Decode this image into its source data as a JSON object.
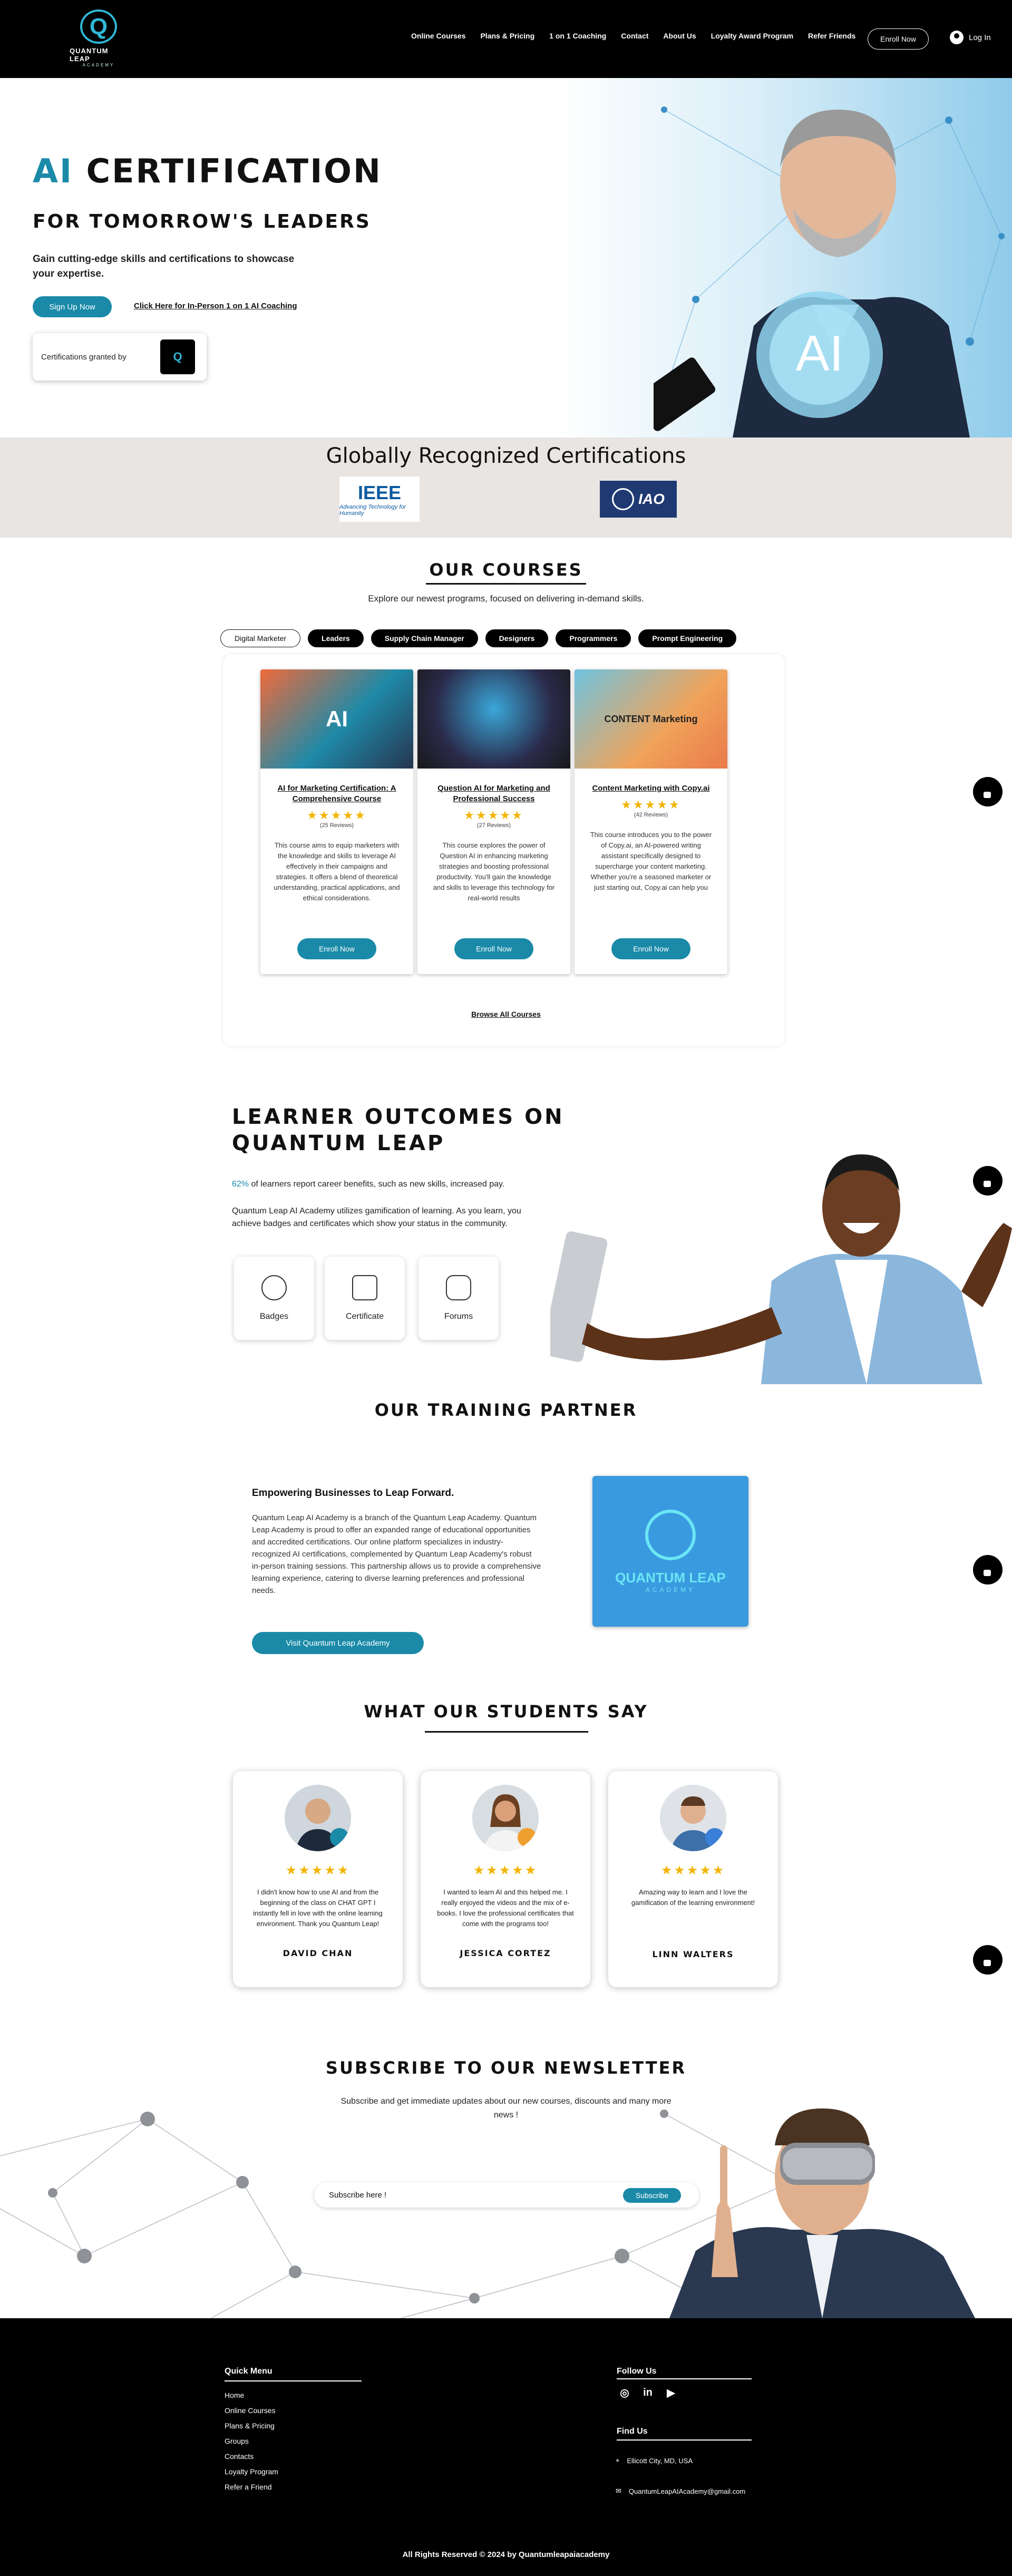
{
  "header": {
    "logo_text": "QUANTUM LEAP",
    "logo_sub": "ACADEMY",
    "nav": [
      "Online Courses",
      "Plans & Pricing",
      "1 on 1 Coaching",
      "Contact",
      "About Us",
      "Loyalty Award Program",
      "Refer Friends"
    ],
    "enroll_label": "Enroll Now",
    "login_label": "Log In"
  },
  "hero": {
    "title_accent": "AI",
    "title_rest": "CERTIFICATION",
    "subtitle": "FOR TOMORROW'S LEADERS",
    "description": "Gain cutting-edge skills and certifications to showcase your expertise.",
    "signup_label": "Sign Up Now",
    "coaching_link": "Click Here for In-Person 1 on 1 AI Coaching",
    "granted_label": "Certifications granted by",
    "globe_text": "AI"
  },
  "certifications": {
    "title": "Globally Recognized Certifications",
    "ieee_name": "IEEE",
    "ieee_tagline": "Advancing Technology for Humanity",
    "iao_name": "IAO"
  },
  "courses": {
    "title": "OUR COURSES",
    "subtitle": "Explore our newest programs, focused on delivering in-demand skills.",
    "tabs": [
      "Digital Marketer",
      "Leaders",
      "Supply Chain Manager",
      "Designers",
      "Programmers",
      "Prompt Engineering"
    ],
    "cards": [
      {
        "img_text": "AI",
        "title": "AI for Marketing Certification: A Comprehensive Course",
        "stars": "★★★★★",
        "reviews": "(25 Reviews)",
        "description": "This course aims to equip marketers with the knowledge and skills to leverage AI effectively in their campaigns and strategies. It offers a blend of theoretical understanding, practical applications, and ethical considerations.",
        "button": "Enroll Now"
      },
      {
        "img_text": "",
        "title": "Question AI for Marketing and Professional Success",
        "stars": "★★★★★",
        "reviews": "(27 Reviews)",
        "description": "This course explores the power of Question AI in enhancing marketing strategies and boosting professional productivity. You'll gain the knowledge and skills to leverage this technology for real-world results",
        "button": "Enroll Now"
      },
      {
        "img_text": "CONTENT Marketing",
        "title": "Content Marketing with Copy.ai",
        "stars": "★★★★★",
        "reviews": "(42 Reviews)",
        "description": "This course introduces you to the power of Copy.ai, an AI-powered writing assistant specifically designed to supercharge your content marketing. Whether you're a seasoned marketer or just starting out, Copy.ai can help you",
        "button": "Enroll Now"
      }
    ],
    "browse_label": "Browse All Courses"
  },
  "outcomes": {
    "title_line1": "LEARNER OUTCOMES ON",
    "title_line2": "QUANTUM LEAP",
    "stat_pct": "62%",
    "stat_text": " of learners report career benefits, such as new skills, increased pay.",
    "description": "Quantum Leap AI Academy utilizes gamification of learning.  As you learn, you achieve badges and certificates which show your status in the community.",
    "cards": [
      "Badges",
      "Certificate",
      "Forums"
    ]
  },
  "partner": {
    "title": "OUR TRAINING PARTNER",
    "heading": "Empowering Businesses to Leap Forward.",
    "description": "Quantum Leap AI Academy is a branch of the Quantum Leap Academy. Quantum Leap Academy is proud to offer an expanded range of educational opportunities and accredited certifications. Our online platform specializes in industry-recognized AI certifications, complemented by Quantum Leap Academy's robust in-person training sessions. This partnership allows us to provide a comprehensive learning experience, catering to diverse learning preferences and professional needs.",
    "button": "Visit Quantum Leap Academy",
    "logo_name": "QUANTUM LEAP",
    "logo_sub": "ACADEMY"
  },
  "testimonials": {
    "title": "WHAT OUR STUDENTS SAY",
    "items": [
      {
        "stars": "★★★★★",
        "text": "I didn't know how to use AI and from the beginning of the class on CHAT GPT I instantly fell in love with the online learning environment.  Thank you Quantum Leap!",
        "name": "DAVID CHAN"
      },
      {
        "stars": "★★★★★",
        "text": "I wanted to learn AI and this helped me. I really enjoyed the videos and the mix of e-books. I love the professional certificates that come with the programs too!",
        "name": "JESSICA CORTEZ"
      },
      {
        "stars": "★★★★★",
        "text": "Amazing way to learn and I love the gamification of the learning environment!",
        "name": "LINN WALTERS"
      }
    ]
  },
  "newsletter": {
    "title": "SUBSCRIBE TO OUR NEWSLETTER",
    "subtitle": "Subscribe and get immediate updates about our new courses, discounts and many more news !",
    "placeholder": "Subscribe here !",
    "button": "Subscribe"
  },
  "footer": {
    "menu_title": "Quick Menu",
    "links": [
      "Home",
      "Online Courses",
      "Plans & Pricing",
      "Groups",
      "Contacts",
      "Loyalty Program",
      "Refer a Friend"
    ],
    "follow_title": "Follow Us",
    "social": [
      "instagram-icon",
      "linkedin-icon",
      "youtube-icon"
    ],
    "social_glyphs": [
      "◎",
      "in",
      "▶"
    ],
    "find_title": "Find Us",
    "address": "Ellicott City, MD, USA",
    "email": "QuantumLeapAIAcademy@gmail.com",
    "copyright": "All Rights Reserved © 2024 by Quantumleapaiacademy"
  },
  "colors": {
    "accent": "#1a8aa8",
    "star": "#f2b400",
    "header_bg": "#000000",
    "cert_band": "#e8e5e3"
  }
}
